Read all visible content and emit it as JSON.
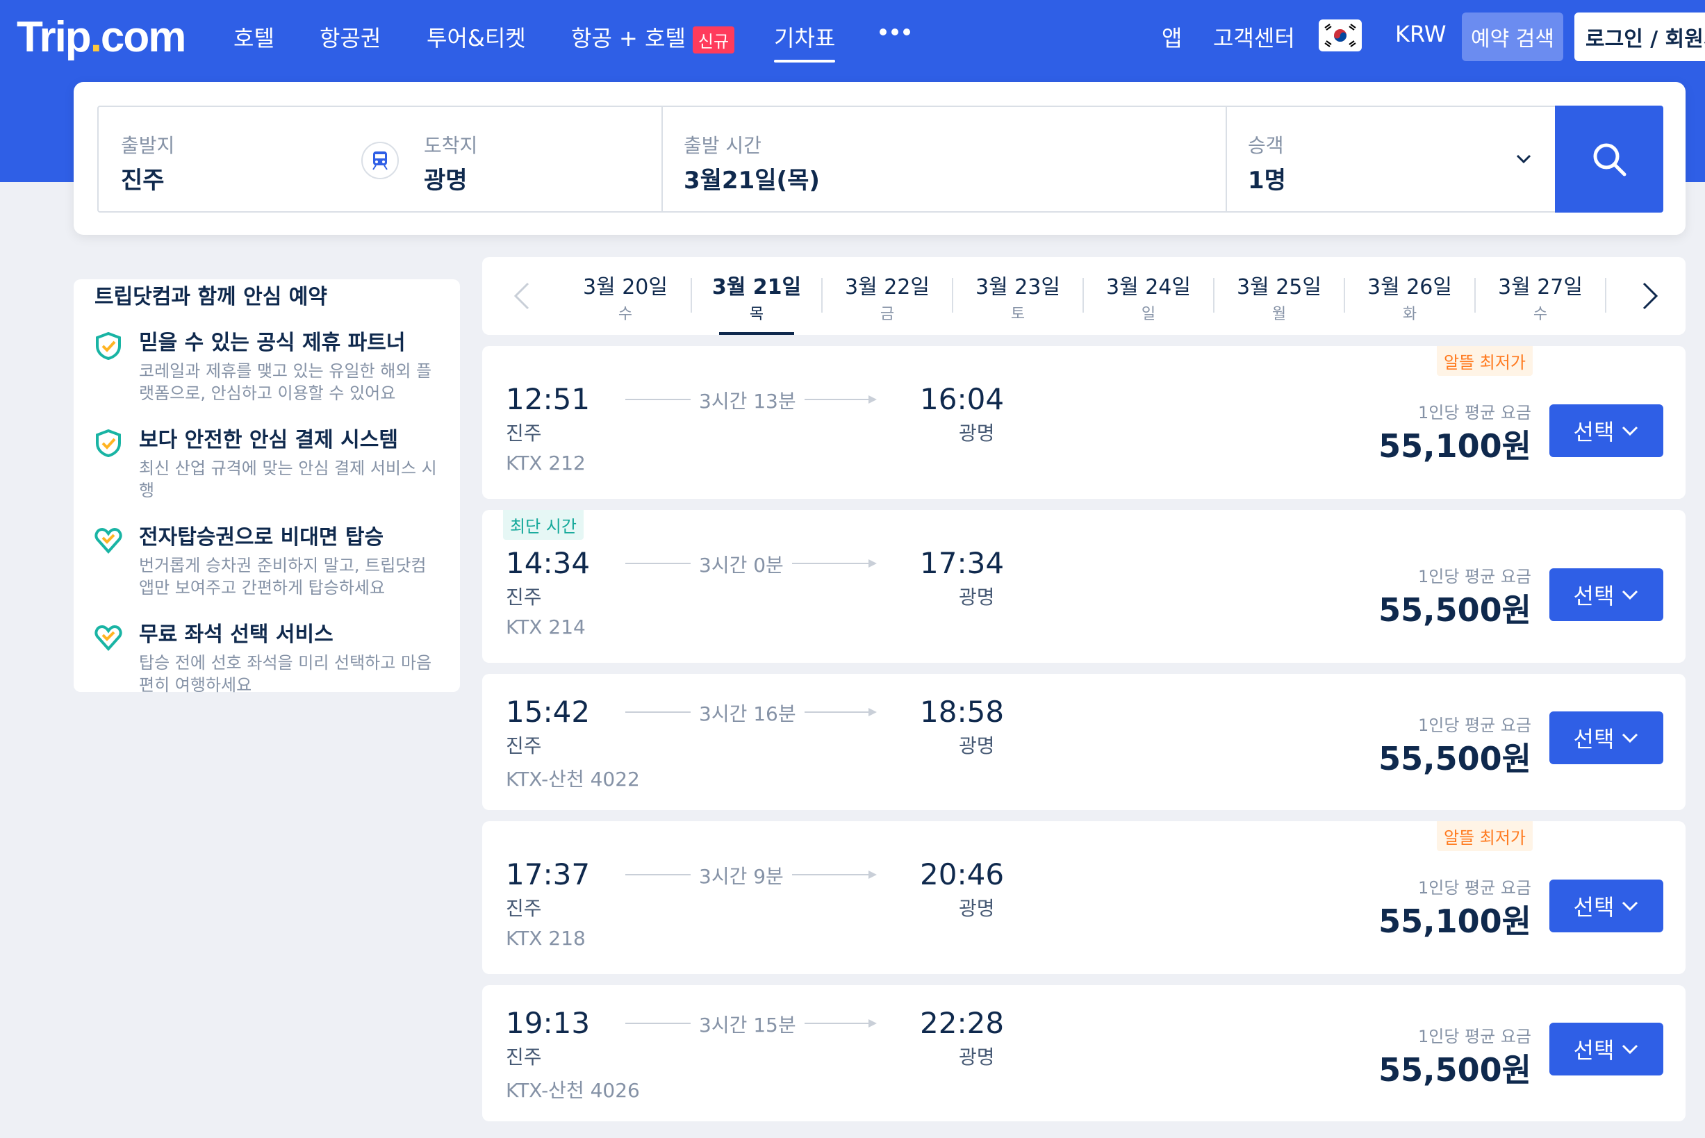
{
  "header": {
    "logo_main": "Trip",
    "logo_dot": ".",
    "logo_suffix": "com",
    "nav": [
      {
        "label": "호텔"
      },
      {
        "label": "항공권"
      },
      {
        "label": "투어&티켓"
      },
      {
        "label": "항공 + 호텔",
        "badge": "신규"
      },
      {
        "label": "기차표"
      }
    ],
    "right": {
      "app": "앱",
      "customer_center": "고객센터",
      "currency": "KRW",
      "reserve_search": "예약 검색",
      "login": "로그인 / 회원가입"
    },
    "colors": {
      "brand": "#2f5fe6",
      "accent": "#ffc83c"
    }
  },
  "search": {
    "origin_label": "출발지",
    "origin": "진주",
    "dest_label": "도착지",
    "dest": "광명",
    "time_label": "출발 시간",
    "time": "3월21일(목)",
    "passenger_label": "승객",
    "passenger": "1명"
  },
  "promo": {
    "title": "트립닷컴과 함께 안심 예약",
    "items": [
      {
        "icon": "shield-check-icon",
        "title": "믿을 수 있는 공식 제휴 파트너",
        "desc": "코레일과 제휴를 맺고 있는 유일한 해외 플랫폼으로, 안심하고 이용할 수 있어요"
      },
      {
        "icon": "shield-check-icon",
        "title": "보다 안전한 안심 결제 시스템",
        "desc": "최신 산업 규격에 맞는 안심 결제 서비스 시행"
      },
      {
        "icon": "heart-check-icon",
        "title": "전자탑승권으로 비대면 탑승",
        "desc": "번거롭게 승차권 준비하지 말고, 트립닷컴 앱만 보여주고 간편하게 탑승하세요"
      },
      {
        "icon": "heart-check-icon",
        "title": "무료 좌석 선택 서비스",
        "desc": "탑승 전에 선호 좌석을 미리 선택하고 마음 편히 여행하세요"
      }
    ]
  },
  "dates": [
    {
      "date": "3월 20일",
      "weekday": "수",
      "active": false
    },
    {
      "date": "3월 21일",
      "weekday": "목",
      "active": true
    },
    {
      "date": "3월 22일",
      "weekday": "금",
      "active": false
    },
    {
      "date": "3월 23일",
      "weekday": "토",
      "active": false
    },
    {
      "date": "3월 24일",
      "weekday": "일",
      "active": false
    },
    {
      "date": "3월 25일",
      "weekday": "월",
      "active": false
    },
    {
      "date": "3월 26일",
      "weekday": "화",
      "active": false
    },
    {
      "date": "3월 27일",
      "weekday": "수",
      "active": false
    }
  ],
  "trains": [
    {
      "dep": "12:51",
      "dep_st": "진주",
      "arr": "16:04",
      "arr_st": "광명",
      "duration": "3시간 13분",
      "no": "KTX 212",
      "price_label": "1인당 평균 요금",
      "price": "55,100원",
      "tag": "알뜰 최저가",
      "tag_type": "cheap",
      "select": "선택"
    },
    {
      "dep": "14:34",
      "dep_st": "진주",
      "arr": "17:34",
      "arr_st": "광명",
      "duration": "3시간 0분",
      "no": "KTX 214",
      "price_label": "1인당 평균 요금",
      "price": "55,500원",
      "tag": "최단 시간",
      "tag_type": "fast",
      "select": "선택"
    },
    {
      "dep": "15:42",
      "dep_st": "진주",
      "arr": "18:58",
      "arr_st": "광명",
      "duration": "3시간 16분",
      "no": "KTX-산천 4022",
      "price_label": "1인당 평균 요금",
      "price": "55,500원",
      "tag": "",
      "tag_type": "",
      "select": "선택"
    },
    {
      "dep": "17:37",
      "dep_st": "진주",
      "arr": "20:46",
      "arr_st": "광명",
      "duration": "3시간 9분",
      "no": "KTX 218",
      "price_label": "1인당 평균 요금",
      "price": "55,100원",
      "tag": "알뜰 최저가",
      "tag_type": "cheap",
      "select": "선택"
    },
    {
      "dep": "19:13",
      "dep_st": "진주",
      "arr": "22:28",
      "arr_st": "광명",
      "duration": "3시간 15분",
      "no": "KTX-산천 4026",
      "price_label": "1인당 평균 요금",
      "price": "55,500원",
      "tag": "",
      "tag_type": "",
      "select": "선택"
    }
  ]
}
